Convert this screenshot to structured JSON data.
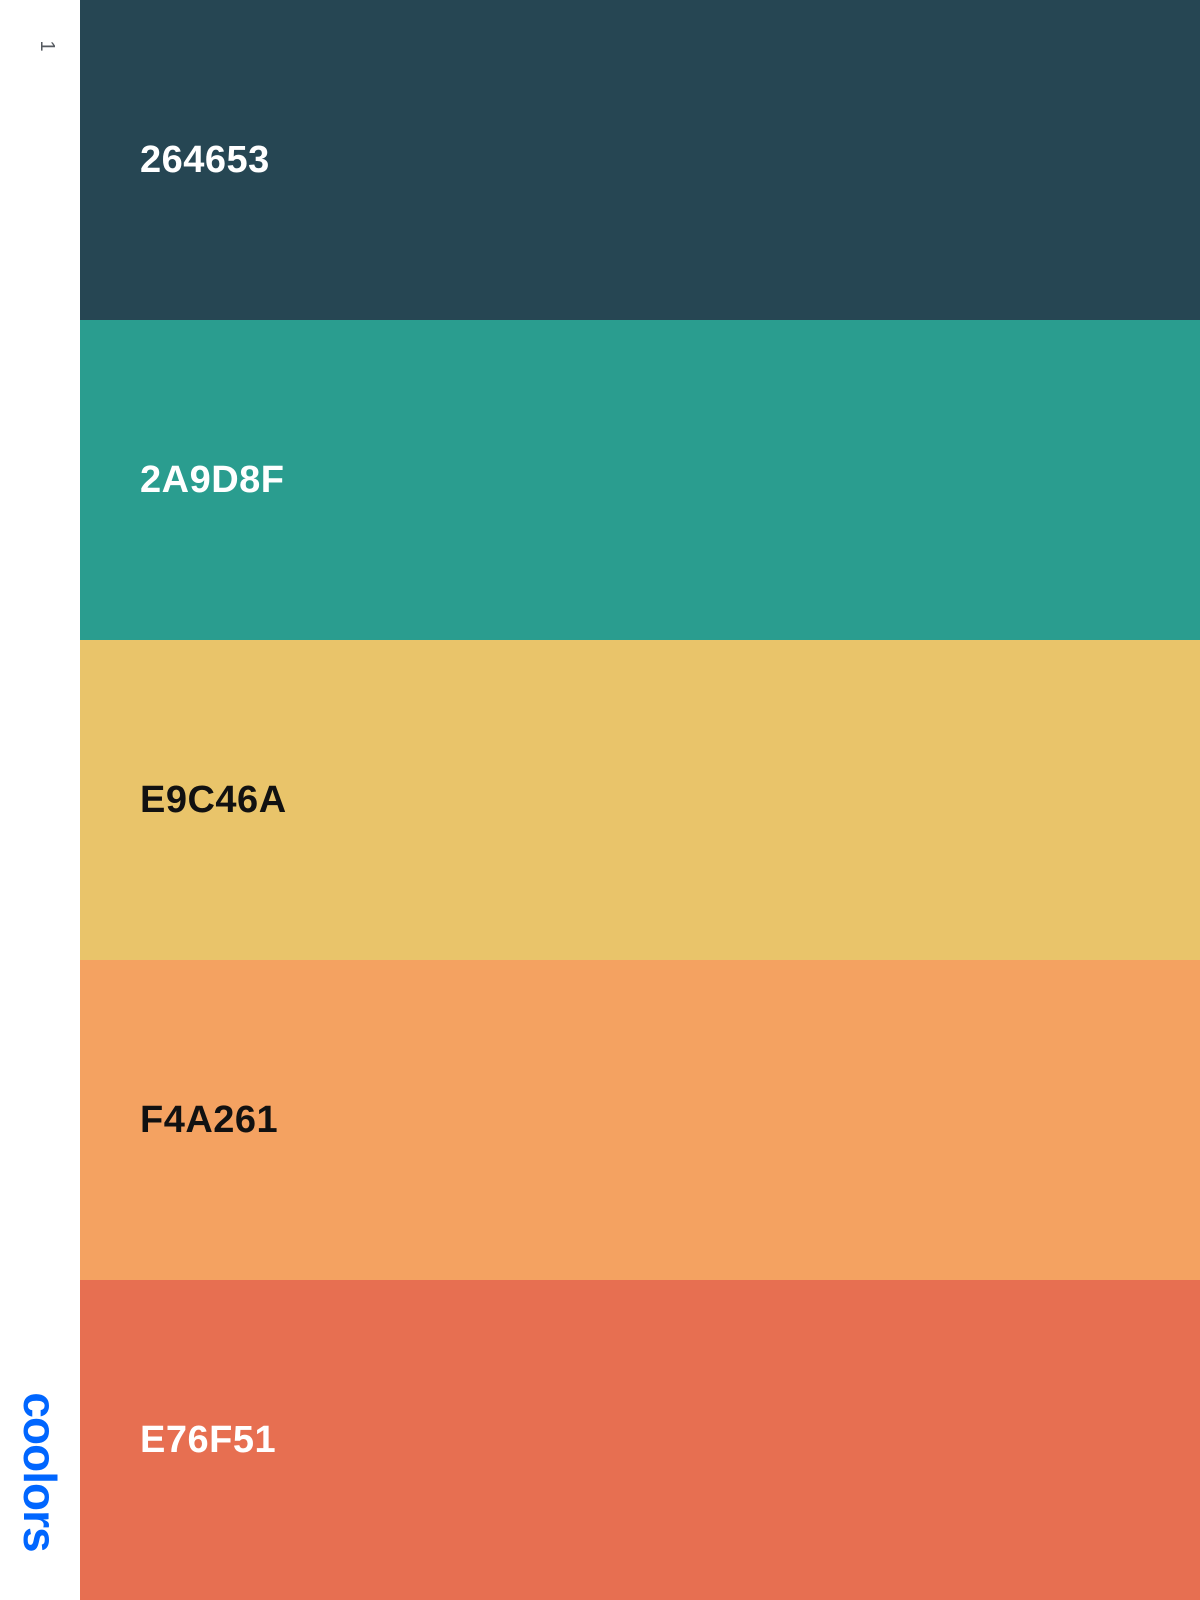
{
  "sidebar": {
    "page_number": "1",
    "brand": "coolors",
    "brand_color": "#0066ff"
  },
  "palette": [
    {
      "hex": "264653",
      "color": "#264653",
      "text_color": "#ffffff"
    },
    {
      "hex": "2A9D8F",
      "color": "#2A9D8F",
      "text_color": "#ffffff"
    },
    {
      "hex": "E9C46A",
      "color": "#E9C46A",
      "text_color": "#111111"
    },
    {
      "hex": "F4A261",
      "color": "#F4A261",
      "text_color": "#111111"
    },
    {
      "hex": "E76F51",
      "color": "#E76F51",
      "text_color": "#ffffff"
    }
  ]
}
